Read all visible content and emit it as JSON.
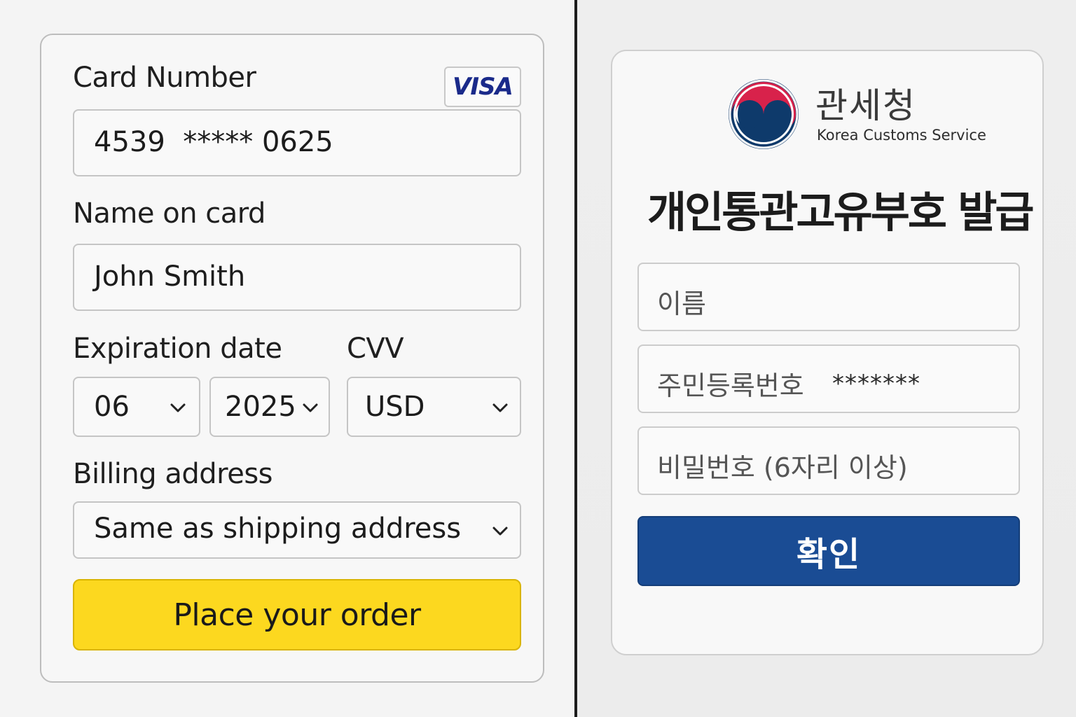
{
  "payment": {
    "card_number_label": "Card Number",
    "card_brand": "VISA",
    "card_number_value": "4539  ***** 0625",
    "name_label": "Name on card",
    "name_value": "John Smith",
    "expiration_label": "Expiration date",
    "cvv_label": "CVV",
    "exp_month": "06",
    "exp_year": "2025",
    "cvv_select": "USD",
    "billing_label": "Billing address",
    "billing_value": "Same as shipping address",
    "submit_label": "Place your order",
    "accent_color": "#fcd81f"
  },
  "customs": {
    "org_name_ko": "관세청",
    "org_name_en": "Korea Customs Service",
    "title": "개인통관고유부호 발급",
    "name_placeholder": "이름",
    "rrn_label": "주민등록번호",
    "rrn_mask": "*******",
    "password_placeholder": "비밀번호 (6자리 이상)",
    "confirm_label": "확인",
    "accent_color": "#1a4c94"
  }
}
